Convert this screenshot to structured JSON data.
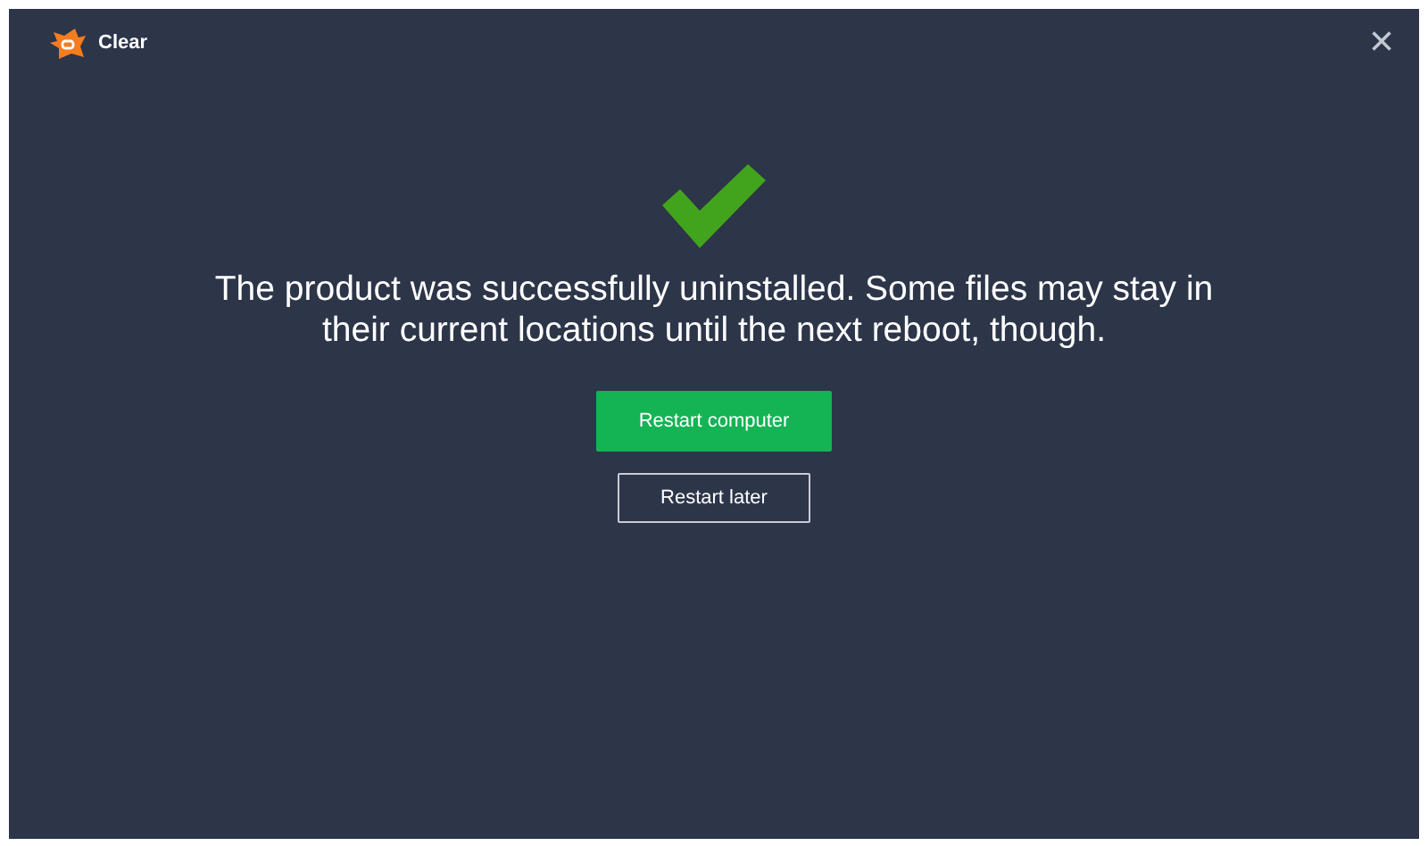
{
  "window": {
    "title": "Clear",
    "close": "×"
  },
  "message": "The product was successfully uninstalled. Some files may stay in their current locations until the next reboot, though.",
  "buttons": [
    {
      "label": "Restart computer",
      "kind": "primary"
    },
    {
      "label": "Restart later",
      "kind": "secondary"
    }
  ]
}
